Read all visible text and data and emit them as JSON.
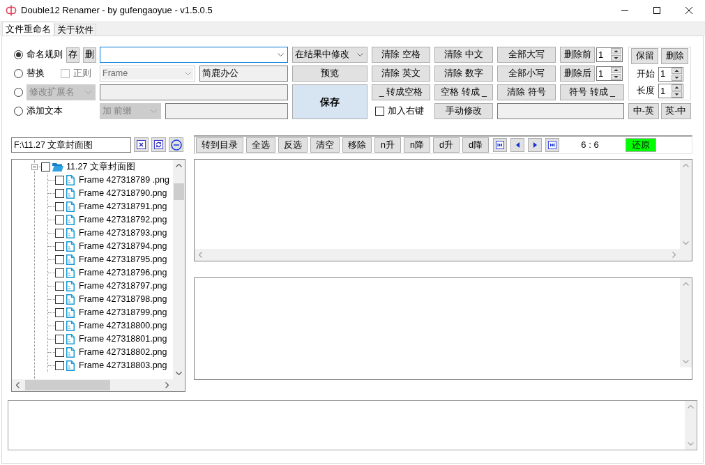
{
  "window": {
    "title": "Double12 Renamer - by gufengaoyue - v1.5.0.5"
  },
  "tabs": [
    {
      "label": "文件重命名",
      "selected": true
    },
    {
      "label": "关于软件",
      "selected": false
    }
  ],
  "modes": [
    {
      "kind": "rule",
      "label": "命名规则",
      "selected": true
    },
    {
      "kind": "replace",
      "label": "替换",
      "selected": false
    },
    {
      "kind": "extension",
      "selected": false
    },
    {
      "kind": "add_text",
      "label": "添加文本",
      "selected": false
    }
  ],
  "rule": {
    "save_button": "存",
    "delete_button": "删"
  },
  "replace": {
    "regex": {
      "label": "正则",
      "checked": false,
      "disabled": true
    },
    "find": {
      "value": "Frame",
      "disabled": true
    },
    "replace_with": {
      "value": "简鹿办公"
    }
  },
  "extension": {
    "mode": {
      "value": "修改扩展名",
      "disabled": true
    }
  },
  "add_text": {
    "position": {
      "value": "加 前缀",
      "disabled": true
    }
  },
  "apply_mode": {
    "value": "在结果中修改"
  },
  "preview_button": "预览",
  "save_button": "保存",
  "actions": [
    [
      {
        "kind": "button",
        "label": "清除 空格"
      },
      {
        "kind": "button",
        "label": "清除 中文"
      },
      {
        "kind": "button",
        "label": "全部大写"
      },
      {
        "kind": "spinner_button",
        "label": "删除前",
        "value": "1"
      }
    ],
    [
      {
        "kind": "button",
        "label": "清除 英文"
      },
      {
        "kind": "button",
        "label": "清除 数字"
      },
      {
        "kind": "button",
        "label": "全部小写"
      },
      {
        "kind": "spinner_button",
        "label": "删除后",
        "value": "1"
      }
    ],
    [
      {
        "kind": "button",
        "label": "_ 转成空格"
      },
      {
        "kind": "button",
        "label": "空格 转成 _"
      },
      {
        "kind": "button",
        "label": "清除 符号"
      },
      {
        "kind": "button",
        "label": "符号 转成 _"
      }
    ]
  ],
  "right_click_option": {
    "label": "加入右键",
    "checked": false
  },
  "manual_edit_button": "手动修改",
  "trim": {
    "keep_button": "保留",
    "remove_button": "删除",
    "fields": [
      {
        "label": "开始",
        "value": "1"
      },
      {
        "label": "长度",
        "value": "1"
      }
    ]
  },
  "translate_buttons": [
    "中-英",
    "英-中"
  ],
  "path": "F:\\11.27 文章封面图",
  "tree": {
    "label": "11.27 文章封面图",
    "checked": false,
    "expanded": true,
    "children": [
      {
        "label": "Frame 427318789 .png",
        "checked": false
      },
      {
        "label": "Frame 427318790.png",
        "checked": false
      },
      {
        "label": "Frame 427318791.png",
        "checked": false
      },
      {
        "label": "Frame 427318792.png",
        "checked": false
      },
      {
        "label": "Frame 427318793.png",
        "checked": false
      },
      {
        "label": "Frame 427318794.png",
        "checked": false
      },
      {
        "label": "Frame 427318795.png",
        "checked": false
      },
      {
        "label": "Frame 427318796.png",
        "checked": false
      },
      {
        "label": "Frame 427318797.png",
        "checked": false
      },
      {
        "label": "Frame 427318798.png",
        "checked": false
      },
      {
        "label": "Frame 427318799.png",
        "checked": false
      },
      {
        "label": "Frame 427318800.png",
        "checked": false
      },
      {
        "label": "Frame 427318801.png",
        "checked": false
      },
      {
        "label": "Frame 427318802.png",
        "checked": false
      },
      {
        "label": "Frame 427318803.png",
        "checked": false
      }
    ]
  },
  "list_toolbar": {
    "buttons": [
      "转到目录",
      "全选",
      "反选",
      "清空",
      "移除",
      "n升",
      "n降",
      "d升",
      "d降"
    ],
    "counter": "6 : 6",
    "restore_button": "还原"
  }
}
